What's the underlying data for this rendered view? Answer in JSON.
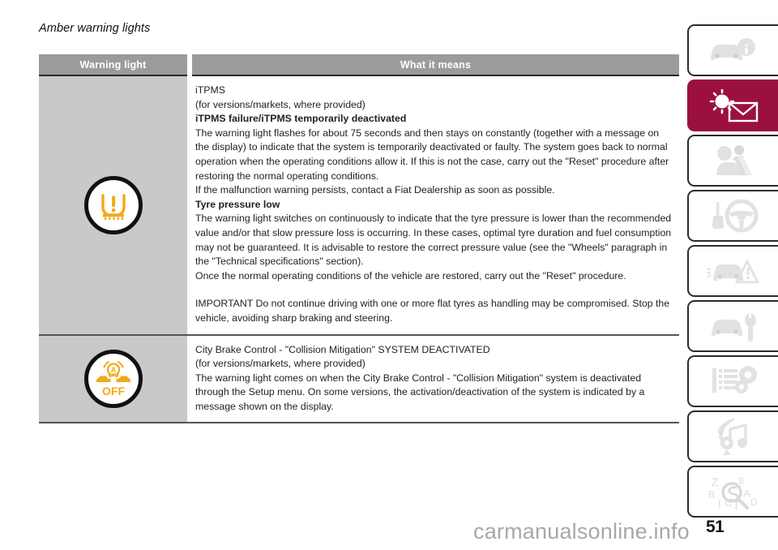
{
  "page": {
    "heading": "Amber warning lights",
    "number": "51",
    "watermark": "carmanualsonline.info"
  },
  "table": {
    "headers": {
      "warning_light": "Warning light",
      "what_it_means": "What it means"
    },
    "rows": [
      {
        "icon_name": "tpms-warning-light-icon",
        "lines": [
          {
            "text": "iTPMS",
            "bold": false
          },
          {
            "text": "(for versions/markets, where provided)",
            "bold": false
          },
          {
            "text": "iTPMS failure/iTPMS temporarily deactivated",
            "bold": true
          },
          {
            "text": "The warning light flashes for about 75 seconds and then stays on constantly (together with a message on the display) to indicate that the system is temporarily deactivated or faulty. The system goes back to normal operation when the operating conditions allow it. If this is not the case, carry out the \"Reset\" procedure after restoring the normal operating conditions.",
            "bold": false
          },
          {
            "text": "If the malfunction warning persists, contact a Fiat Dealership as soon as possible.",
            "bold": false
          },
          {
            "text": "Tyre pressure low",
            "bold": true
          },
          {
            "text": "The warning light switches on continuously to indicate that the tyre pressure is lower than the recommended value and/or that slow pressure loss is occurring. In these cases, optimal tyre duration and fuel consumption may not be guaranteed. It is advisable to restore the correct pressure value (see the \"Wheels\" paragraph in the \"Technical specifications\" section).",
            "bold": false
          },
          {
            "text": "Once the normal operating conditions of the vehicle are restored, carry out the \"Reset\" procedure.",
            "bold": false
          },
          {
            "text": "",
            "bold": false
          },
          {
            "text": "IMPORTANT Do not continue driving with one or more flat tyres as handling may be compromised. Stop the vehicle, avoiding sharp braking and steering.",
            "bold": false
          }
        ]
      },
      {
        "icon_name": "city-brake-control-off-icon",
        "icon_label": "OFF",
        "lines": [
          {
            "text": "City Brake Control - \"Collision Mitigation\" SYSTEM DEACTIVATED",
            "bold": false
          },
          {
            "text": "(for versions/markets, where provided)",
            "bold": false
          },
          {
            "text": "The warning light comes on when the City Brake Control - \"Collision Mitigation\" system is deactivated through the Setup menu. On some versions, the activation/deactivation of the system is indicated by a message shown on the display.",
            "bold": false
          }
        ]
      }
    ]
  },
  "sidebar": {
    "active_index": 1,
    "tabs": [
      {
        "icon": "car-info-icon",
        "label": "Dashboard and controls"
      },
      {
        "icon": "warning-lights-message-icon",
        "label": "Warning lights and messages"
      },
      {
        "icon": "occupant-safety-icon",
        "label": "Safety"
      },
      {
        "icon": "key-steering-wheel-icon",
        "label": "Starting and driving"
      },
      {
        "icon": "car-hazard-triangle-icon",
        "label": "In an emergency"
      },
      {
        "icon": "car-wrench-icon",
        "label": "Maintenance and care"
      },
      {
        "icon": "list-gears-icon",
        "label": "Technical specifications"
      },
      {
        "icon": "radio-music-icon",
        "label": "Multimedia"
      },
      {
        "icon": "alphabetical-index-icon",
        "label": "Alphabetical index"
      }
    ]
  },
  "colors": {
    "accent": "#9c1040",
    "header_gray": "#9b9b9b",
    "cell_gray": "#c9c9c9",
    "amber": "#f0aa19"
  }
}
